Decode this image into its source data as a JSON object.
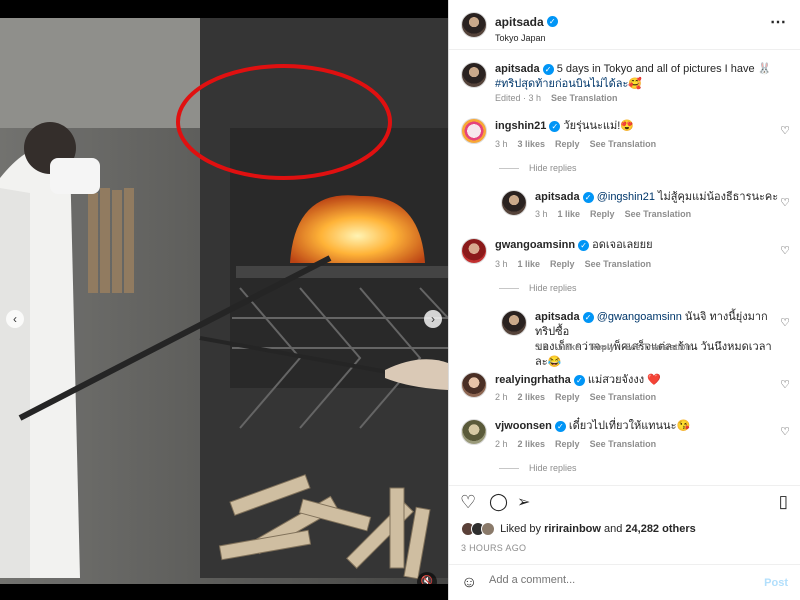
{
  "post": {
    "username": "apitsada",
    "location": "Tokyo Japan",
    "caption_text": "5 days in Tokyo and all of pictures I have 🐰 ",
    "caption_tag": "#ทริปสุดท้ายก่อนบินไม่ได้ละ",
    "caption_emoji": "🥰",
    "edited": "Edited · 3 h",
    "see_translation": "See Translation"
  },
  "comments": [
    {
      "user": "ingshin21",
      "text": "วัยรุ่นนะแม่!😍",
      "time": "3 h",
      "likes": "3 likes",
      "reply": "Reply",
      "translate": "See Translation",
      "hide": "Hide replies"
    },
    {
      "user": "apitsada",
      "mention": "@ingshin21",
      "text": " ไม่สู้คุมแม่น้องธีธารนะคะ",
      "time": "3 h",
      "likes": "1 like",
      "reply": "Reply",
      "translate": "See Translation"
    },
    {
      "user": "gwangoamsinn",
      "text": "อดเจอเลยยย",
      "time": "3 h",
      "likes": "1 like",
      "reply": "Reply",
      "translate": "See Translation",
      "hide": "Hide replies"
    },
    {
      "user": "apitsada",
      "mention": "@gwangoamsinn",
      "text": " นันจิ ทางนี้ยุ่งมากทริปซื้อ",
      "text2": "ของเด็ก กว่าจะแพ็คเสร็จแต่ละร้าน วันนึงหมดเวลาละ😂",
      "time": "3 h",
      "likes": "1 like",
      "reply": "Reply",
      "translate": "See Translation"
    },
    {
      "user": "realyingrhatha",
      "text": "แม่สวยจังงง ❤️",
      "time": "2 h",
      "likes": "2 likes",
      "reply": "Reply",
      "translate": "See Translation"
    },
    {
      "user": "vjwoonsen",
      "text": "เดี๋ยวไปเที่ยวให้แทนนะ😘",
      "time": "2 h",
      "likes": "2 likes",
      "reply": "Reply",
      "translate": "See Translation",
      "hide": "Hide replies"
    }
  ],
  "likes": {
    "prefix": "Liked by ",
    "user": "ririrainbow",
    "and": " and ",
    "count": "24,282 others"
  },
  "time_ago": "3 HOURS AGO",
  "add_comment": {
    "placeholder": "Add a comment...",
    "post": "Post"
  },
  "icons": {
    "more": "more-horizontal-icon",
    "heart": "heart-icon",
    "comment": "comment-icon",
    "share": "share-icon",
    "save": "bookmark-icon",
    "emoji": "emoji-icon",
    "mute": "mute-icon"
  },
  "colors": {
    "verified": "#0095f6",
    "link": "#00376b",
    "muted": "#8e8e8e",
    "post": "#b2dffc",
    "annotation": "#e01010"
  },
  "carousel": {
    "total": 10,
    "active": 9
  }
}
